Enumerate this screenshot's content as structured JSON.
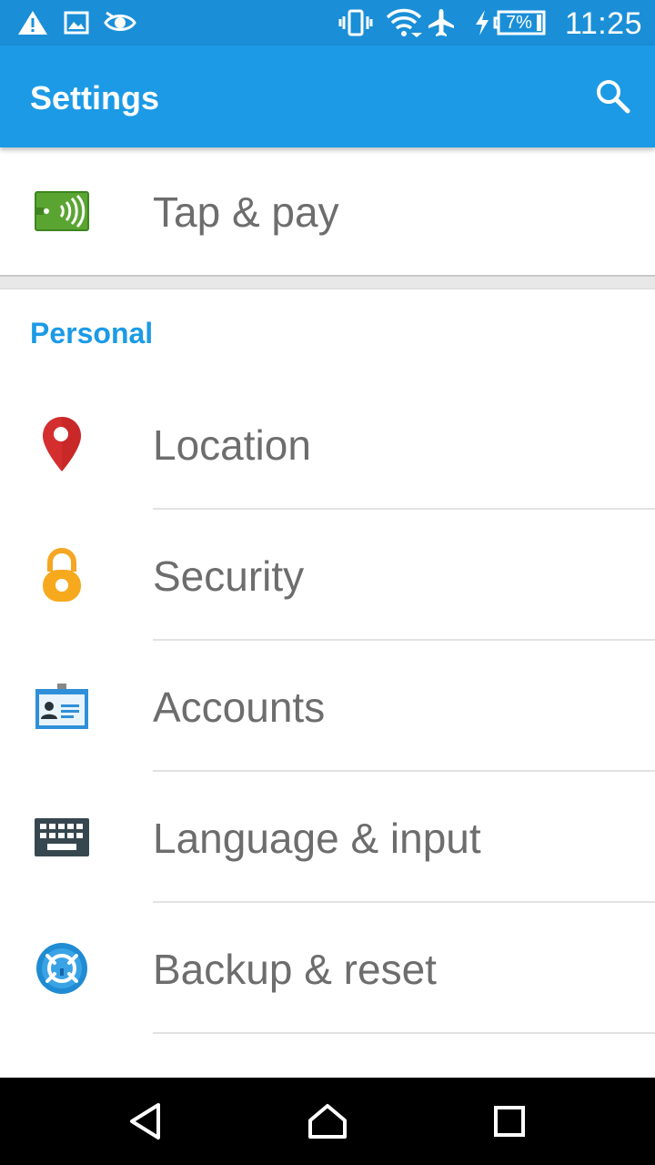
{
  "status_bar": {
    "time": "11:25",
    "battery_percent": "7%",
    "icons": [
      "warning-icon",
      "image-icon",
      "eye-icon",
      "vibrate-icon",
      "wifi-icon",
      "airplane-icon",
      "charging-icon",
      "battery-icon"
    ]
  },
  "app_bar": {
    "title": "Settings",
    "search_icon": "search-icon"
  },
  "top_item": {
    "label": "Tap & pay",
    "icon": "nfc-icon"
  },
  "personal_section": {
    "header": "Personal",
    "items": [
      {
        "label": "Location",
        "icon": "location-pin-icon"
      },
      {
        "label": "Security",
        "icon": "lock-icon"
      },
      {
        "label": "Accounts",
        "icon": "account-card-icon"
      },
      {
        "label": "Language & input",
        "icon": "keyboard-icon"
      },
      {
        "label": "Backup & reset",
        "icon": "backup-icon"
      }
    ]
  },
  "nav_bar": {
    "buttons": [
      "back-icon",
      "home-icon",
      "recents-icon"
    ]
  },
  "colors": {
    "status_bar": "#1a8fd8",
    "app_bar": "#1c9ae6",
    "accent": "#1c9ae6",
    "label_text": "#6d6d6d"
  }
}
